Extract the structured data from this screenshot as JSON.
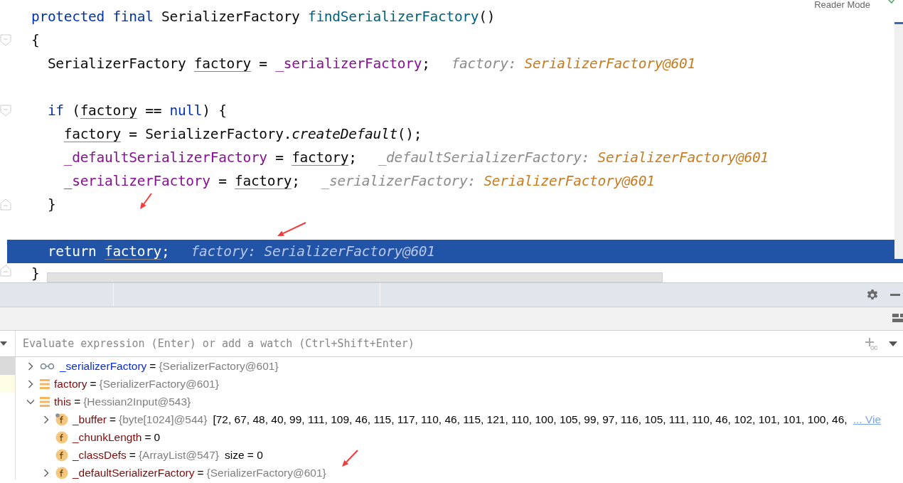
{
  "editor": {
    "reader_mode": "Reader Mode",
    "lines": [
      {
        "kind": "plain",
        "selected": false,
        "tokens": [
          {
            "kind": "keyword",
            "t": "protected final "
          },
          {
            "kind": "plain",
            "t": "SerializerFactory "
          },
          {
            "kind": "declaration",
            "t": "findSerializerFactory"
          },
          {
            "kind": "plain",
            "t": "()"
          }
        ]
      },
      {
        "kind": "fold-start",
        "selected": false,
        "tokens": [
          {
            "kind": "plain",
            "t": "{"
          }
        ]
      },
      {
        "kind": "plain",
        "selected": false,
        "tokens": [
          {
            "kind": "plain",
            "t": "  SerializerFactory "
          },
          {
            "kind": "local",
            "t": "factory"
          },
          {
            "kind": "plain",
            "t": " = "
          },
          {
            "kind": "field",
            "t": "_serializerFactory"
          },
          {
            "kind": "plain",
            "t": ";"
          },
          {
            "kind": "hint-label",
            "t": "factory: "
          },
          {
            "kind": "hint-value",
            "t": "SerializerFactory@601"
          }
        ]
      },
      {
        "kind": "plain",
        "selected": false
      },
      {
        "kind": "fold-start",
        "selected": false,
        "tokens": [
          {
            "kind": "keyword",
            "t": "  if "
          },
          {
            "kind": "plain",
            "t": "("
          },
          {
            "kind": "local",
            "t": "factory"
          },
          {
            "kind": "plain",
            "t": " == "
          },
          {
            "kind": "keyword",
            "t": "null"
          },
          {
            "kind": "plain",
            "t": ") {"
          }
        ]
      },
      {
        "kind": "plain",
        "selected": false,
        "tokens": [
          {
            "kind": "local",
            "t": "    factory"
          },
          {
            "kind": "plain",
            "t": " = SerializerFactory."
          },
          {
            "kind": "static",
            "t": "createDefault"
          },
          {
            "kind": "plain",
            "t": "();"
          }
        ]
      },
      {
        "kind": "plain",
        "selected": false,
        "tokens": [
          {
            "kind": "field",
            "t": "    _defaultSerializerFactory"
          },
          {
            "kind": "plain",
            "t": " = "
          },
          {
            "kind": "local",
            "t": "factory"
          },
          {
            "kind": "plain",
            "t": ";"
          },
          {
            "kind": "hint-label",
            "t": "_defaultSerializerFactory: "
          },
          {
            "kind": "hint-value",
            "t": "SerializerFactory@601"
          }
        ]
      },
      {
        "kind": "plain",
        "selected": false,
        "tokens": [
          {
            "kind": "field",
            "t": "    _serializerFactory"
          },
          {
            "kind": "plain",
            "t": " = "
          },
          {
            "kind": "local",
            "t": "factory"
          },
          {
            "kind": "plain",
            "t": ";"
          },
          {
            "kind": "hint-label",
            "t": "_serializerFactory: "
          },
          {
            "kind": "hint-value",
            "t": "SerializerFactory@601"
          }
        ]
      },
      {
        "kind": "fold-end",
        "selected": false,
        "tokens": [
          {
            "kind": "plain",
            "t": "  }"
          }
        ]
      },
      {
        "kind": "plain",
        "selected": false
      },
      {
        "kind": "plain",
        "selected": true,
        "tokens": [
          {
            "kind": "keyword",
            "t": "  return "
          },
          {
            "kind": "local",
            "t": "factory"
          },
          {
            "kind": "plain",
            "t": ";"
          },
          {
            "kind": "hint-label",
            "t": "factory: "
          },
          {
            "kind": "hint-value",
            "t": "SerializerFactory@601"
          }
        ]
      },
      {
        "kind": "fold-end",
        "selected": false,
        "tokens": [
          {
            "kind": "plain",
            "t": "}"
          }
        ]
      }
    ]
  },
  "debugger": {
    "evaluate": {
      "placeholder": "Evaluate expression (Enter) or add a watch (Ctrl+Shift+Enter)"
    },
    "variables": [
      {
        "kind": "watch",
        "name": "_serializerFactory",
        "sep": "=",
        "value": "{SerializerFactory@601}",
        "expandable": true,
        "expanded": false
      },
      {
        "kind": "variable",
        "name": "factory",
        "sep": "=",
        "value": "{SerializerFactory@601}",
        "expandable": true,
        "expanded": false
      },
      {
        "kind": "variable",
        "name": "this",
        "sep": "=",
        "value": "{Hessian2Input@543}",
        "expandable": true,
        "expanded": true,
        "children": [
          {
            "kind": "field",
            "name": "_buffer",
            "sep": "=",
            "value": "{byte[1024]@544}",
            "extra": "[72, 67, 48, 40, 99, 111, 109, 46, 115, 117, 110, 46, 115, 121, 110, 100, 105, 99, 97, 116, 105, 111, 110, 46, 102, 101, 101, 100, 46,",
            "link": "... Vie",
            "icon_overlay": true,
            "expandable": true,
            "expanded": false
          },
          {
            "kind": "field",
            "name": "_chunkLength",
            "sep": "=",
            "plain_value": "0",
            "icon_overlay": false,
            "expandable": false
          },
          {
            "kind": "field",
            "name": "_classDefs",
            "sep": "=",
            "value": "{ArrayList@547}",
            "extra": "size = 0",
            "icon_overlay": false,
            "expandable": false
          },
          {
            "kind": "field",
            "name": "_defaultSerializerFactory",
            "sep": "=",
            "value": "{SerializerFactory@601}",
            "icon_overlay": false,
            "expandable": true,
            "expanded": false
          }
        ]
      }
    ]
  }
}
